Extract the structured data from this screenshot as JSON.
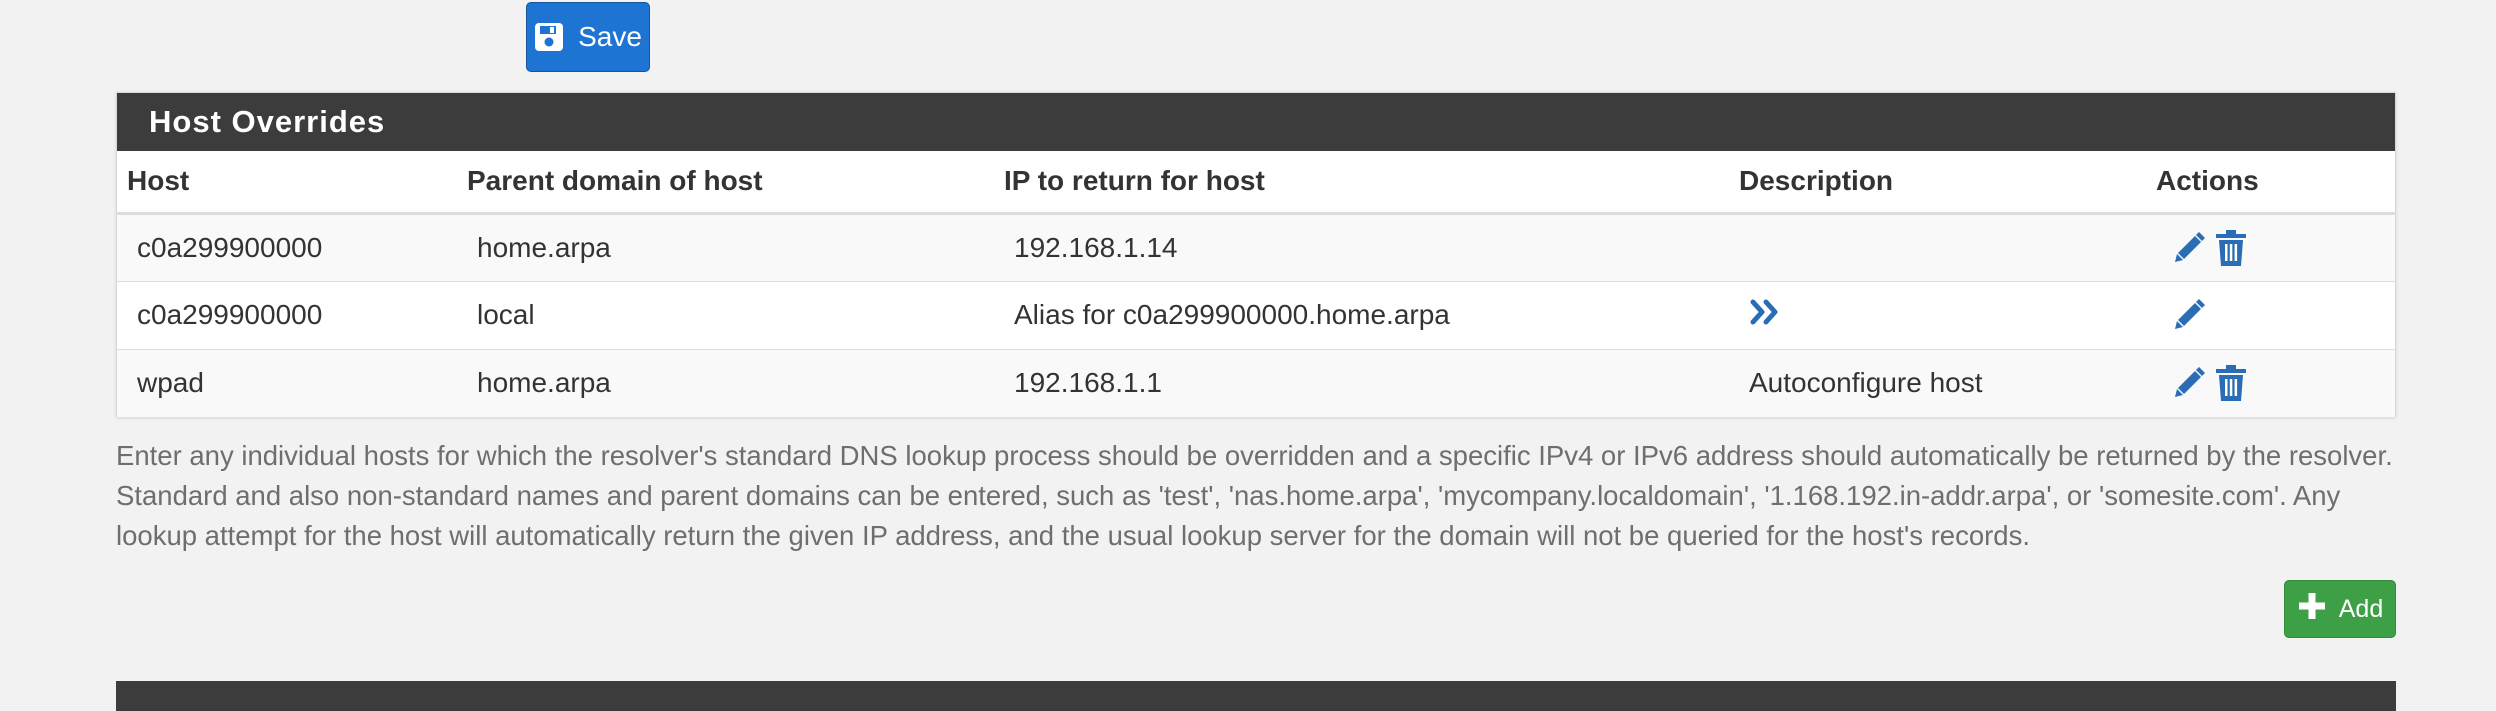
{
  "toolbar": {
    "save_label": "Save"
  },
  "panel": {
    "title": "Host Overrides",
    "columns": [
      "Host",
      "Parent domain of host",
      "IP to return for host",
      "Description",
      "Actions"
    ],
    "rows": [
      {
        "host": "c0a299900000",
        "parent": "home.arpa",
        "ip": "192.168.1.14",
        "description": "",
        "actions": [
          "edit-icon",
          "delete-icon"
        ]
      },
      {
        "host": "c0a299900000",
        "parent": "local",
        "ip": "Alias for c0a299900000.home.arpa",
        "description": "",
        "description_icon": "double-chevron-right-icon",
        "actions": [
          "edit-icon"
        ]
      },
      {
        "host": "wpad",
        "parent": "home.arpa",
        "ip": "192.168.1.1",
        "description": "Autoconfigure host",
        "actions": [
          "edit-icon",
          "delete-icon"
        ]
      }
    ]
  },
  "help_text": "Enter any individual hosts for which the resolver's standard DNS lookup process should be overridden and a specific IPv4 or IPv6 address should automatically be returned by the resolver. Standard and also non-standard names and parent domains can be entered, such as 'test', 'nas.home.arpa', 'mycompany.localdomain', '1.168.192.in-addr.arpa', or 'somesite.com'. Any lookup attempt for the host will automatically return the given IP address, and the usual lookup server for the domain will not be queried for the host's records.",
  "add_button": {
    "label": "Add"
  },
  "colors": {
    "save_button": "#1e74d3",
    "add_button": "#3ea046",
    "panel_heading": "#3c3c3c",
    "icon_blue": "#2a6db5"
  }
}
